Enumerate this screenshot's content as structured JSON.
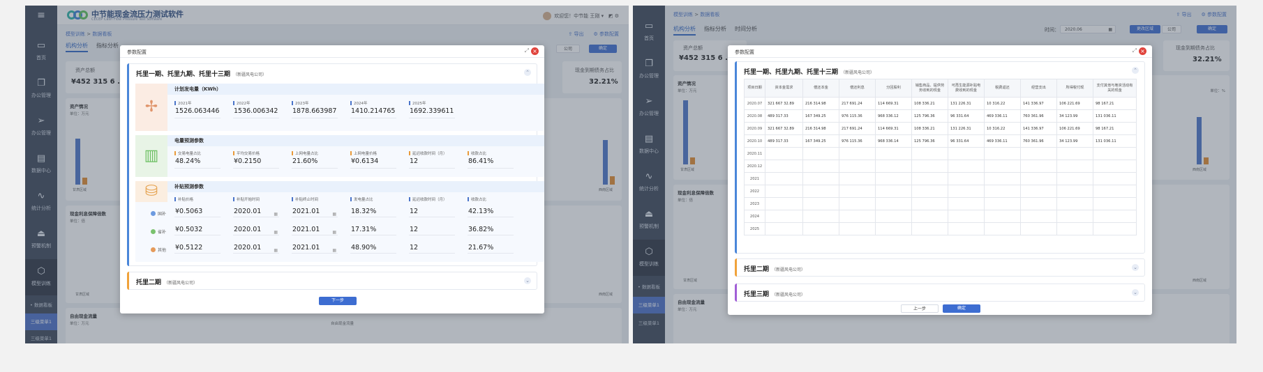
{
  "sidebar": {
    "items": [
      {
        "label": "首页",
        "icon": "monitor-icon"
      },
      {
        "label": "办公管理",
        "icon": "copy-icon"
      },
      {
        "label": "办公管理",
        "icon": "send-icon"
      },
      {
        "label": "数据中心",
        "icon": "folder-icon"
      },
      {
        "label": "统计分析",
        "icon": "pulse-icon"
      },
      {
        "label": "预警机制",
        "icon": "alarm-icon"
      },
      {
        "label": "模型训练",
        "icon": "cube-icon"
      }
    ],
    "sub": [
      "• 数据看板",
      "三级菜单1",
      "三级菜单1"
    ]
  },
  "app": {
    "title": "中节能现金流压力测试软件",
    "subtitle": "CECEP Cash Flow Pressure Test Software"
  },
  "user": {
    "greeting": "欢迎您！中节能  王刚"
  },
  "breadcrumb": {
    "parent": "模型训练",
    "sep": " > ",
    "current": "数据看板"
  },
  "tabs": [
    "机构分析",
    "指标分析",
    "时间分析"
  ],
  "toolbar": {
    "export": "⇪ 导出",
    "config": "⚙ 参数配置",
    "time_label": "时间：",
    "time_value": "2020.06",
    "region": "更改区域",
    "company": "公司",
    "confirm": "确定"
  },
  "kpis": {
    "total_assets_label": "资产总额",
    "total_assets_value": "¥452 315 6 .88",
    "cash_label": "现金到期债务占比",
    "cash_value": "32.21%",
    "cash_value_s1": "32.21%"
  },
  "sections": {
    "asset": "资产情况",
    "cashflow_guarantee": "现金利息保障倍数",
    "free_cash": "自由现金流量",
    "unit_wan": "单位：万元",
    "unit_pct": "单位：%",
    "unit_times": "单位：倍",
    "legend_free": "自由现金流量"
  },
  "regions": {
    "a": "甘肃区域",
    "b": "西南区域"
  },
  "modal1": {
    "title": "参数配置",
    "panel_title": "托里一期、托里九期、托里十三期",
    "panel_company": "（新疆风电公司）",
    "groups": {
      "g1": {
        "title": "计划发电量（KWh）",
        "fields": [
          {
            "label": "2021年",
            "value": "1526.063446"
          },
          {
            "label": "2022年",
            "value": "1536.006342"
          },
          {
            "label": "2023年",
            "value": "1878.663987"
          },
          {
            "label": "2024年",
            "value": "1410.214765"
          },
          {
            "label": "2025年",
            "value": "1692.339611"
          }
        ]
      },
      "g2": {
        "title": "电量预测参数",
        "fields": [
          {
            "label": "交易电量占比",
            "value": "48.24%"
          },
          {
            "label": "平均交易价格",
            "value": "¥0.2150"
          },
          {
            "label": "上网电量占比",
            "value": "21.60%"
          },
          {
            "label": "上网电量价格",
            "value": "¥0.6134"
          },
          {
            "label": "延迟收款时间（月）",
            "value": "12"
          },
          {
            "label": "收款占比",
            "value": "86.41%"
          }
        ]
      },
      "g3": {
        "title": "补贴预测参数",
        "headers": [
          "补贴价格",
          "补贴开始时间",
          "补贴终止时间",
          "发电量占比",
          "延迟收款时间（月）",
          "收款占比"
        ],
        "rows": [
          {
            "tag": "国补",
            "values": [
              "¥0.5063",
              "2020.01",
              "2021.01",
              "18.32%",
              "12",
              "42.13%"
            ]
          },
          {
            "tag": "省补",
            "values": [
              "¥0.5032",
              "2020.01",
              "2021.01",
              "17.31%",
              "12",
              "36.82%"
            ]
          },
          {
            "tag": "其他",
            "values": [
              "¥0.5122",
              "2020.01",
              "2021.01",
              "48.90%",
              "12",
              "21.67%"
            ]
          }
        ]
      }
    },
    "panel2_title": "托里二期",
    "panel2_company": "（新疆风电公司）",
    "next": "下一步"
  },
  "modal2": {
    "title": "参数配置",
    "panel_title": "托里一期、托里九期、托里十三期",
    "panel_company": "（新疆风电公司）",
    "headers": [
      "项目日期",
      "资本金需求",
      "偿还本金",
      "偿还利息",
      "分回股利",
      "销售商品、提供劳务收到的现金",
      "可再生能源补贴电费收到的现金",
      "税费返还",
      "经营支出",
      "所得税付现",
      "支付其他与筹资活动有关的现金"
    ],
    "rows": [
      [
        "2020.07",
        "321 667 32.89",
        "216 314.98",
        "217 691.24",
        "114 669.31",
        "108 336.21",
        "131 226.31",
        "10 316.22",
        "141 336.97",
        "106 221.69",
        "98 167.21"
      ],
      [
        "2020.08",
        "489 317.33",
        "167 349.25",
        "976 115.36",
        "968 336.12",
        "125 796.36",
        "96 331.64",
        "469 336.11",
        "760 361.96",
        "34 123.99",
        "131 036.11"
      ],
      [
        "2020.09",
        "321 667 32.89",
        "216 314.98",
        "217 691.24",
        "114 669.31",
        "108 336.21",
        "131 226.31",
        "10 316.22",
        "141 336.97",
        "106 221.69",
        "98 167.21"
      ],
      [
        "2020.10",
        "489 317.33",
        "167 349.25",
        "976 115.36",
        "968 336.14",
        "125 796.36",
        "96 331.64",
        "469 336.11",
        "760 361.96",
        "34 123.99",
        "131 036.11"
      ],
      [
        "2020.11",
        "",
        "",
        "",
        "",
        "",
        "",
        "",
        "",
        "",
        ""
      ],
      [
        "2020.12",
        "",
        "",
        "",
        "",
        "",
        "",
        "",
        "",
        "",
        ""
      ],
      [
        "2021",
        "",
        "",
        "",
        "",
        "",
        "",
        "",
        "",
        "",
        ""
      ],
      [
        "2022",
        "",
        "",
        "",
        "",
        "",
        "",
        "",
        "",
        "",
        ""
      ],
      [
        "2023",
        "",
        "",
        "",
        "",
        "",
        "",
        "",
        "",
        "",
        ""
      ],
      [
        "2024",
        "",
        "",
        "",
        "",
        "",
        "",
        "",
        "",
        "",
        ""
      ],
      [
        "2025",
        "",
        "",
        "",
        "",
        "",
        "",
        "",
        "",
        "",
        ""
      ]
    ],
    "panel2_title": "托里二期",
    "panel2_company": "（新疆风电公司）",
    "panel3_title": "托里三期",
    "panel3_company": "（新疆风电公司）",
    "prev": "上一步",
    "confirm": "确定"
  },
  "colors": {
    "primary": "#3d6dd1",
    "sidebar": "#3c4657",
    "panel1": "#4a86d9",
    "panel2": "#f0a23a",
    "panel3": "#a15fd6"
  }
}
